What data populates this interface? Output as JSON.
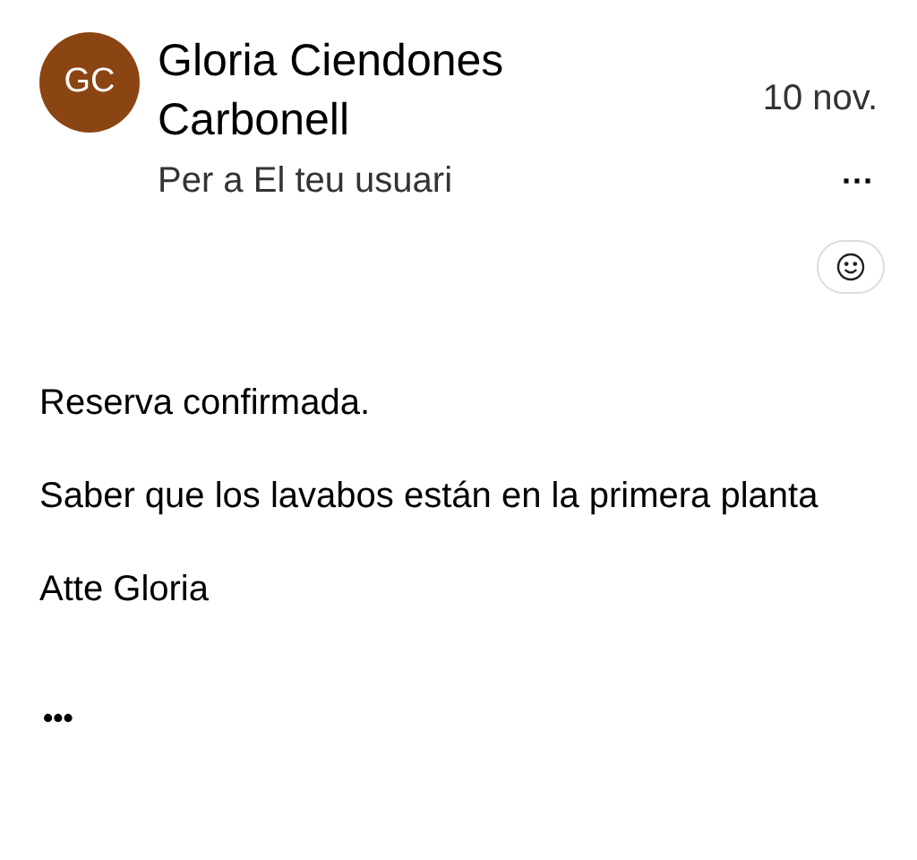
{
  "sender": {
    "initials": "GC",
    "name": "Gloria Ciendones Carbonell",
    "color": "#8b4513"
  },
  "date": "10 nov.",
  "recipient": "Per a El teu usuari",
  "more": "···",
  "body": [
    "Reserva confirmada.",
    "Saber que los lavabos están en la primera planta",
    "Atte Gloria"
  ],
  "trimmed": "•••"
}
